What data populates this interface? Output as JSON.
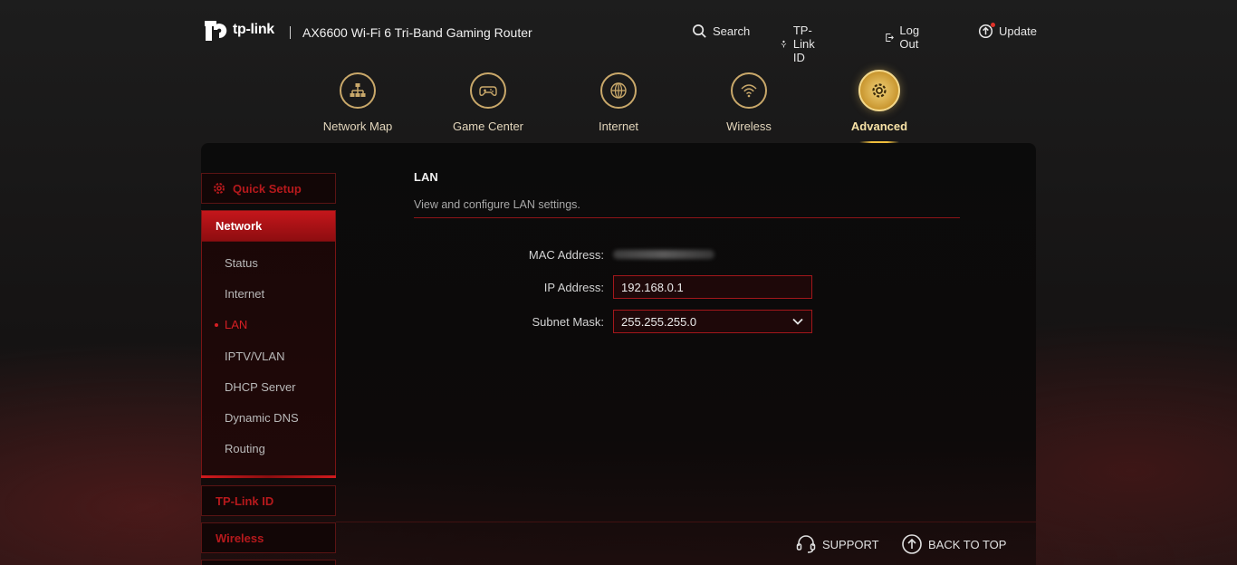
{
  "header": {
    "brand": "tp-link",
    "model": "AX6600 Wi-Fi 6 Tri-Band Gaming Router",
    "links": {
      "search": "Search",
      "tplink_id": "TP-Link ID",
      "logout": "Log Out",
      "update": "Update"
    }
  },
  "nav": {
    "network_map": "Network Map",
    "game_center": "Game Center",
    "internet": "Internet",
    "wireless": "Wireless",
    "advanced": "Advanced",
    "active": "Advanced"
  },
  "sidebar": {
    "quick_setup": "Quick Setup",
    "network": {
      "label": "Network",
      "items": [
        "Status",
        "Internet",
        "LAN",
        "IPTV/VLAN",
        "DHCP Server",
        "Dynamic DNS",
        "Routing"
      ],
      "active": "LAN"
    },
    "tplink_id": "TP-Link ID",
    "wireless": "Wireless"
  },
  "content": {
    "title": "LAN",
    "description": "View and configure LAN settings.",
    "mac_label": "MAC Address:",
    "ip_label": "IP Address:",
    "ip_value": "192.168.0.1",
    "subnet_label": "Subnet Mask:",
    "subnet_value": "255.255.255.0"
  },
  "footer": {
    "support": "SUPPORT",
    "back_to_top": "BACK TO TOP"
  },
  "colors": {
    "accent_red": "#c4161b",
    "accent_gold": "#f0be3c",
    "background": "#151313"
  }
}
